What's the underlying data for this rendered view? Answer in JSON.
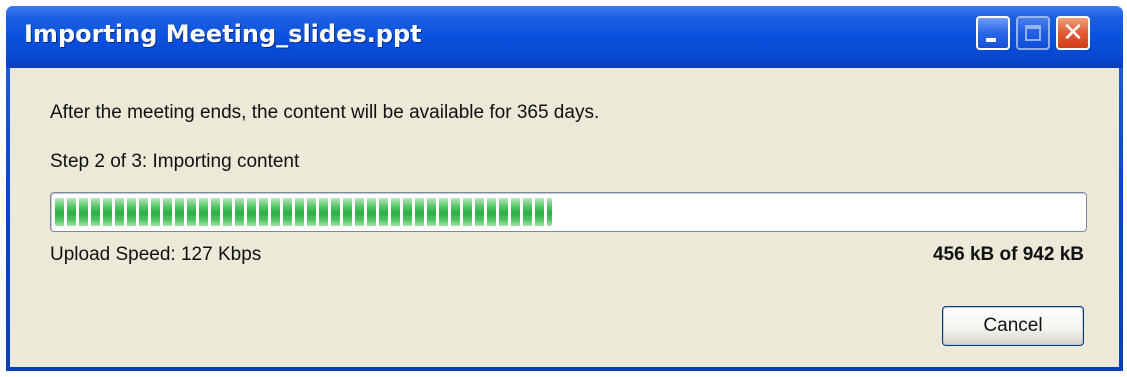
{
  "window": {
    "title": "Importing Meeting_slides.ppt",
    "buttons": {
      "minimize": "minimize-icon",
      "maximize": "maximize-icon",
      "close": "close-icon"
    }
  },
  "dialog": {
    "message": "After the meeting ends, the content will be available for 365 days.",
    "step": "Step 2 of 3:  Importing content",
    "progress_fraction": 0.484,
    "upload_speed": "Upload Speed: 127 Kbps",
    "transfer_size": "456 kB of 942 kB",
    "cancel_label": "Cancel"
  },
  "colors": {
    "titlebar": "#0a52e0",
    "client_bg": "#ece9d8",
    "progress_green": "#2cae44",
    "close_button": "#e2603a"
  }
}
